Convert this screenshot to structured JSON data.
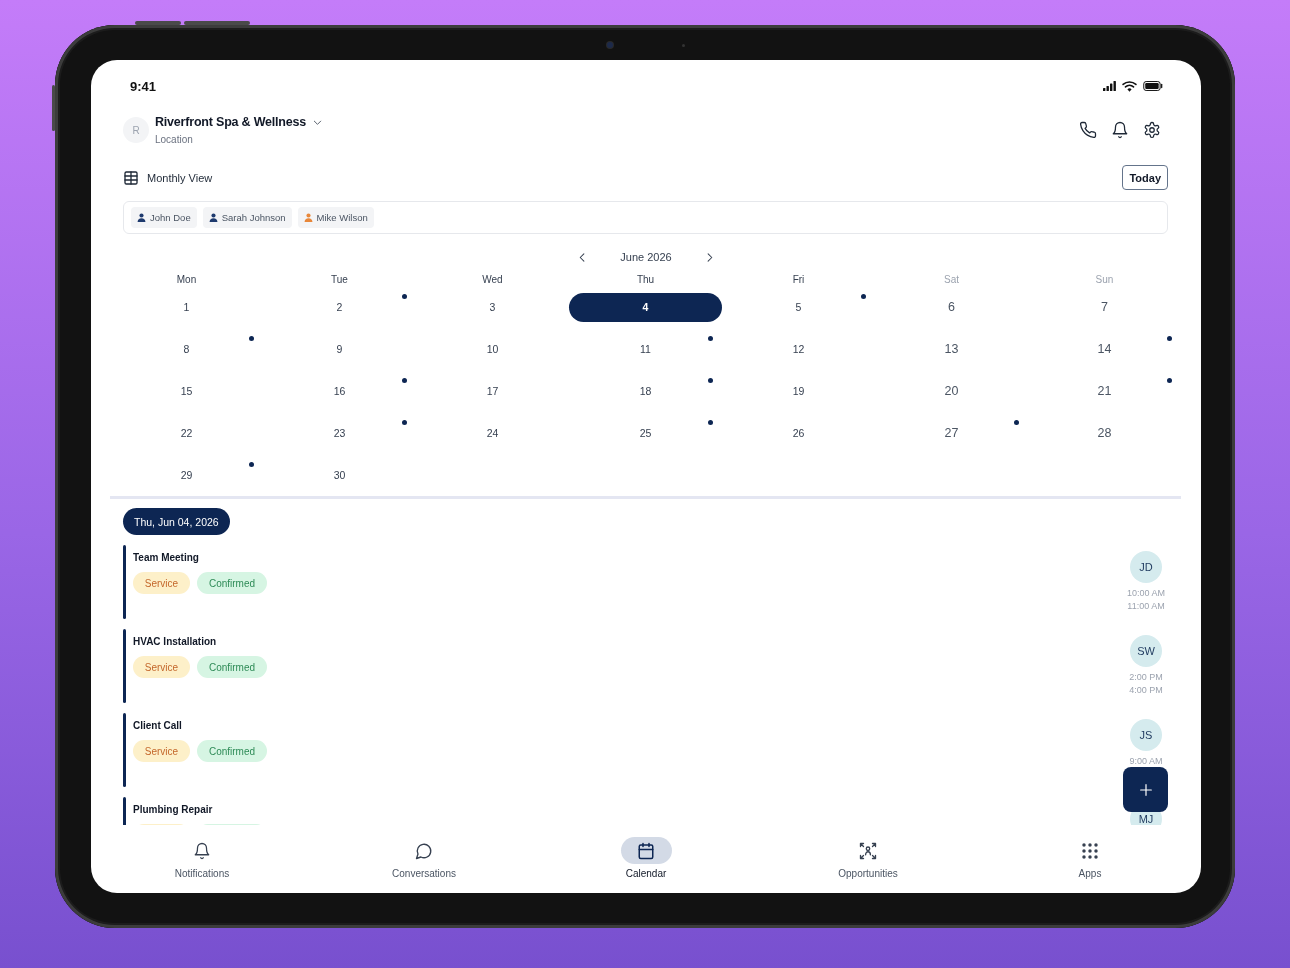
{
  "status_bar": {
    "time": "9:41"
  },
  "header": {
    "avatar_initial": "R",
    "title": "Riverfront Spa & Wellness",
    "subtitle": "Location"
  },
  "view": {
    "label": "Monthly View",
    "today_button": "Today"
  },
  "staff_filter": [
    {
      "name": "John Doe",
      "color": "#1e3a6e"
    },
    {
      "name": "Sarah Johnson",
      "color": "#1e3a6e"
    },
    {
      "name": "Mike Wilson",
      "color": "#e8873a"
    }
  ],
  "calendar": {
    "month": "June 2026",
    "weekdays": [
      {
        "label": "Mon",
        "weekend": false
      },
      {
        "label": "Tue",
        "weekend": false
      },
      {
        "label": "Wed",
        "weekend": false
      },
      {
        "label": "Thu",
        "weekend": false
      },
      {
        "label": "Fri",
        "weekend": false
      },
      {
        "label": "Sat",
        "weekend": true
      },
      {
        "label": "Sun",
        "weekend": true
      }
    ],
    "days": [
      {
        "label": "1",
        "selected": false,
        "has_event": false
      },
      {
        "label": "2",
        "selected": false,
        "has_event": true
      },
      {
        "label": "3",
        "selected": false,
        "has_event": false
      },
      {
        "label": "4",
        "selected": true,
        "has_event": false
      },
      {
        "label": "5",
        "selected": false,
        "has_event": true
      },
      {
        "label": "6",
        "selected": false,
        "has_event": false
      },
      {
        "label": "7",
        "selected": false,
        "has_event": false
      },
      {
        "label": "8",
        "selected": false,
        "has_event": true
      },
      {
        "label": "9",
        "selected": false,
        "has_event": false
      },
      {
        "label": "10",
        "selected": false,
        "has_event": false
      },
      {
        "label": "11",
        "selected": false,
        "has_event": true
      },
      {
        "label": "12",
        "selected": false,
        "has_event": false
      },
      {
        "label": "13",
        "selected": false,
        "has_event": false
      },
      {
        "label": "14",
        "selected": false,
        "has_event": true
      },
      {
        "label": "15",
        "selected": false,
        "has_event": false
      },
      {
        "label": "16",
        "selected": false,
        "has_event": true
      },
      {
        "label": "17",
        "selected": false,
        "has_event": false
      },
      {
        "label": "18",
        "selected": false,
        "has_event": true
      },
      {
        "label": "19",
        "selected": false,
        "has_event": false
      },
      {
        "label": "20",
        "selected": false,
        "has_event": false
      },
      {
        "label": "21",
        "selected": false,
        "has_event": true
      },
      {
        "label": "22",
        "selected": false,
        "has_event": false
      },
      {
        "label": "23",
        "selected": false,
        "has_event": true
      },
      {
        "label": "24",
        "selected": false,
        "has_event": false
      },
      {
        "label": "25",
        "selected": false,
        "has_event": true
      },
      {
        "label": "26",
        "selected": false,
        "has_event": false
      },
      {
        "label": "27",
        "selected": false,
        "has_event": true
      },
      {
        "label": "28",
        "selected": false,
        "has_event": false
      },
      {
        "label": "29",
        "selected": false,
        "has_event": true
      },
      {
        "label": "30",
        "selected": false,
        "has_event": false
      }
    ]
  },
  "agenda": {
    "date": "Thu, Jun 04, 2026",
    "events": [
      {
        "title": "Team Meeting",
        "tags": [
          {
            "kind": "category",
            "label": "Service"
          },
          {
            "kind": "status",
            "label": "Confirmed"
          }
        ],
        "assignee": "JD",
        "times": [
          "10:00 AM",
          "11:00 AM"
        ]
      },
      {
        "title": "HVAC Installation",
        "tags": [
          {
            "kind": "category",
            "label": "Service"
          },
          {
            "kind": "status",
            "label": "Confirmed"
          }
        ],
        "assignee": "SW",
        "times": [
          "2:00 PM",
          "4:00 PM"
        ]
      },
      {
        "title": "Client Call",
        "tags": [
          {
            "kind": "category",
            "label": "Service"
          },
          {
            "kind": "status",
            "label": "Confirmed"
          }
        ],
        "assignee": "JS",
        "times": [
          "9:00 AM"
        ]
      },
      {
        "title": "Plumbing Repair",
        "tags": [
          {
            "kind": "category"
          },
          {
            "kind": "status"
          }
        ],
        "assignee": "MJ"
      }
    ]
  },
  "bottom_nav": [
    {
      "label": "Notifications",
      "selected": false
    },
    {
      "label": "Conversations",
      "selected": false
    },
    {
      "label": "Calendar",
      "selected": true
    },
    {
      "label": "Opportunities",
      "selected": false
    },
    {
      "label": "Apps",
      "selected": false
    }
  ]
}
